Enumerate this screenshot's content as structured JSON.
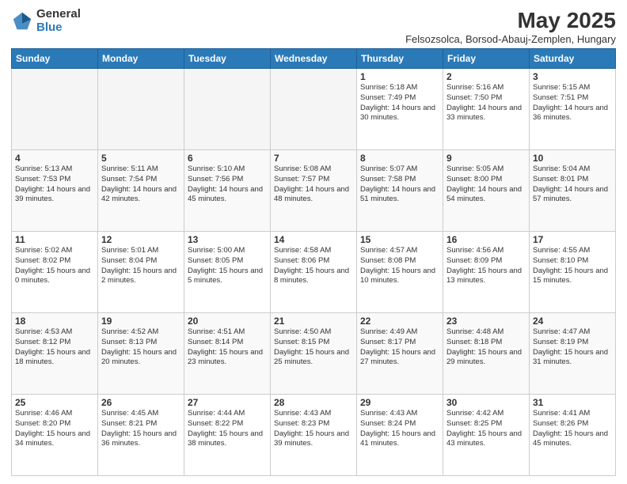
{
  "logo": {
    "general": "General",
    "blue": "Blue"
  },
  "title": "May 2025",
  "subtitle": "Felsozsolca, Borsod-Abauj-Zemplen, Hungary",
  "days_of_week": [
    "Sunday",
    "Monday",
    "Tuesday",
    "Wednesday",
    "Thursday",
    "Friday",
    "Saturday"
  ],
  "weeks": [
    [
      {
        "day": "",
        "info": ""
      },
      {
        "day": "",
        "info": ""
      },
      {
        "day": "",
        "info": ""
      },
      {
        "day": "",
        "info": ""
      },
      {
        "day": "1",
        "info": "Sunrise: 5:18 AM\nSunset: 7:49 PM\nDaylight: 14 hours and 30 minutes."
      },
      {
        "day": "2",
        "info": "Sunrise: 5:16 AM\nSunset: 7:50 PM\nDaylight: 14 hours and 33 minutes."
      },
      {
        "day": "3",
        "info": "Sunrise: 5:15 AM\nSunset: 7:51 PM\nDaylight: 14 hours and 36 minutes."
      }
    ],
    [
      {
        "day": "4",
        "info": "Sunrise: 5:13 AM\nSunset: 7:53 PM\nDaylight: 14 hours and 39 minutes."
      },
      {
        "day": "5",
        "info": "Sunrise: 5:11 AM\nSunset: 7:54 PM\nDaylight: 14 hours and 42 minutes."
      },
      {
        "day": "6",
        "info": "Sunrise: 5:10 AM\nSunset: 7:56 PM\nDaylight: 14 hours and 45 minutes."
      },
      {
        "day": "7",
        "info": "Sunrise: 5:08 AM\nSunset: 7:57 PM\nDaylight: 14 hours and 48 minutes."
      },
      {
        "day": "8",
        "info": "Sunrise: 5:07 AM\nSunset: 7:58 PM\nDaylight: 14 hours and 51 minutes."
      },
      {
        "day": "9",
        "info": "Sunrise: 5:05 AM\nSunset: 8:00 PM\nDaylight: 14 hours and 54 minutes."
      },
      {
        "day": "10",
        "info": "Sunrise: 5:04 AM\nSunset: 8:01 PM\nDaylight: 14 hours and 57 minutes."
      }
    ],
    [
      {
        "day": "11",
        "info": "Sunrise: 5:02 AM\nSunset: 8:02 PM\nDaylight: 15 hours and 0 minutes."
      },
      {
        "day": "12",
        "info": "Sunrise: 5:01 AM\nSunset: 8:04 PM\nDaylight: 15 hours and 2 minutes."
      },
      {
        "day": "13",
        "info": "Sunrise: 5:00 AM\nSunset: 8:05 PM\nDaylight: 15 hours and 5 minutes."
      },
      {
        "day": "14",
        "info": "Sunrise: 4:58 AM\nSunset: 8:06 PM\nDaylight: 15 hours and 8 minutes."
      },
      {
        "day": "15",
        "info": "Sunrise: 4:57 AM\nSunset: 8:08 PM\nDaylight: 15 hours and 10 minutes."
      },
      {
        "day": "16",
        "info": "Sunrise: 4:56 AM\nSunset: 8:09 PM\nDaylight: 15 hours and 13 minutes."
      },
      {
        "day": "17",
        "info": "Sunrise: 4:55 AM\nSunset: 8:10 PM\nDaylight: 15 hours and 15 minutes."
      }
    ],
    [
      {
        "day": "18",
        "info": "Sunrise: 4:53 AM\nSunset: 8:12 PM\nDaylight: 15 hours and 18 minutes."
      },
      {
        "day": "19",
        "info": "Sunrise: 4:52 AM\nSunset: 8:13 PM\nDaylight: 15 hours and 20 minutes."
      },
      {
        "day": "20",
        "info": "Sunrise: 4:51 AM\nSunset: 8:14 PM\nDaylight: 15 hours and 23 minutes."
      },
      {
        "day": "21",
        "info": "Sunrise: 4:50 AM\nSunset: 8:15 PM\nDaylight: 15 hours and 25 minutes."
      },
      {
        "day": "22",
        "info": "Sunrise: 4:49 AM\nSunset: 8:17 PM\nDaylight: 15 hours and 27 minutes."
      },
      {
        "day": "23",
        "info": "Sunrise: 4:48 AM\nSunset: 8:18 PM\nDaylight: 15 hours and 29 minutes."
      },
      {
        "day": "24",
        "info": "Sunrise: 4:47 AM\nSunset: 8:19 PM\nDaylight: 15 hours and 31 minutes."
      }
    ],
    [
      {
        "day": "25",
        "info": "Sunrise: 4:46 AM\nSunset: 8:20 PM\nDaylight: 15 hours and 34 minutes."
      },
      {
        "day": "26",
        "info": "Sunrise: 4:45 AM\nSunset: 8:21 PM\nDaylight: 15 hours and 36 minutes."
      },
      {
        "day": "27",
        "info": "Sunrise: 4:44 AM\nSunset: 8:22 PM\nDaylight: 15 hours and 38 minutes."
      },
      {
        "day": "28",
        "info": "Sunrise: 4:43 AM\nSunset: 8:23 PM\nDaylight: 15 hours and 39 minutes."
      },
      {
        "day": "29",
        "info": "Sunrise: 4:43 AM\nSunset: 8:24 PM\nDaylight: 15 hours and 41 minutes."
      },
      {
        "day": "30",
        "info": "Sunrise: 4:42 AM\nSunset: 8:25 PM\nDaylight: 15 hours and 43 minutes."
      },
      {
        "day": "31",
        "info": "Sunrise: 4:41 AM\nSunset: 8:26 PM\nDaylight: 15 hours and 45 minutes."
      }
    ]
  ]
}
